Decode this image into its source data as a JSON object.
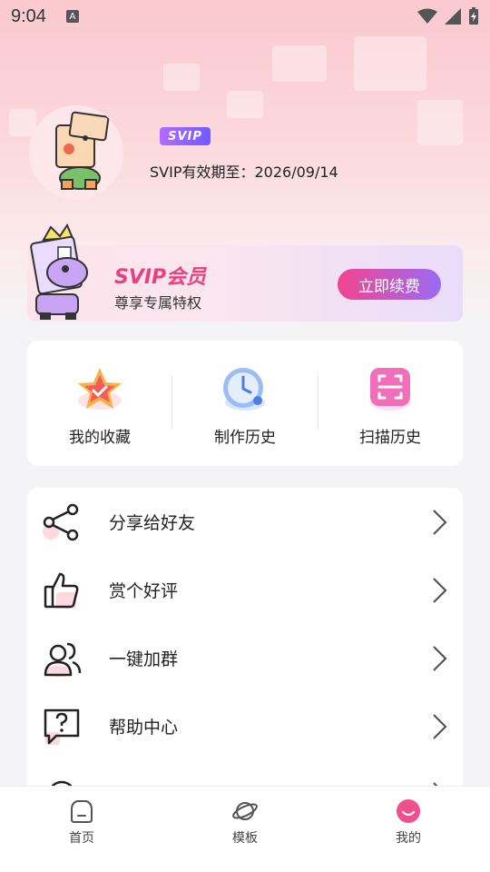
{
  "status_bar": {
    "time": "9:04",
    "notification_icon": "A"
  },
  "profile": {
    "badge": "SVIP",
    "expiry_text": "SVIP有效期至：2026/09/14"
  },
  "banner": {
    "title": "SVIP会员",
    "subtitle": "尊享专属特权",
    "button_label": "立即续费"
  },
  "quick": [
    {
      "label": "我的收藏",
      "icon": "star-icon"
    },
    {
      "label": "制作历史",
      "icon": "clock-icon"
    },
    {
      "label": "扫描历史",
      "icon": "scan-icon"
    }
  ],
  "menu": [
    {
      "label": "分享给好友",
      "icon": "share-icon"
    },
    {
      "label": "赏个好评",
      "icon": "thumbs-up-icon"
    },
    {
      "label": "一键加群",
      "icon": "group-icon"
    },
    {
      "label": "帮助中心",
      "icon": "help-icon"
    }
  ],
  "nav": [
    {
      "label": "首页",
      "icon": "home-icon"
    },
    {
      "label": "模板",
      "icon": "planet-icon"
    },
    {
      "label": "我的",
      "icon": "profile-icon"
    }
  ],
  "colors": {
    "accent": "#e9417f",
    "hero_pink": "#f9c9cf"
  }
}
